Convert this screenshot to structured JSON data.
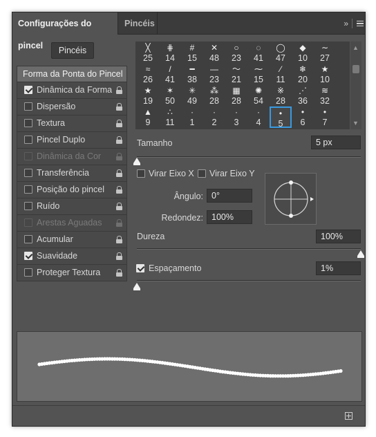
{
  "tabs": {
    "active_label": "Configurações do pincel",
    "inactive_label": "Pincéis"
  },
  "icons": {
    "collapse": "»",
    "menu": "hamburger-menu-icon",
    "new_brush": "new-brush-icon",
    "lock": "lock-icon"
  },
  "sidebar": {
    "brushes_button": "Pincéis",
    "items": [
      {
        "label": "Forma da Ponta do Pincel",
        "checkbox": false,
        "checked": false,
        "disabled": false,
        "lock": false
      },
      {
        "label": "Dinâmica da Forma",
        "checkbox": true,
        "checked": true,
        "disabled": false,
        "lock": true
      },
      {
        "label": "Dispersão",
        "checkbox": true,
        "checked": false,
        "disabled": false,
        "lock": true
      },
      {
        "label": "Textura",
        "checkbox": true,
        "checked": false,
        "disabled": false,
        "lock": true
      },
      {
        "label": "Pincel Duplo",
        "checkbox": true,
        "checked": false,
        "disabled": false,
        "lock": true
      },
      {
        "label": "Dinâmica da Cor",
        "checkbox": true,
        "checked": false,
        "disabled": true,
        "lock": true
      },
      {
        "label": "Transferência",
        "checkbox": true,
        "checked": false,
        "disabled": false,
        "lock": true
      },
      {
        "label": "Posição do pincel",
        "checkbox": true,
        "checked": false,
        "disabled": false,
        "lock": true
      },
      {
        "label": "Ruído",
        "checkbox": true,
        "checked": false,
        "disabled": false,
        "lock": true
      },
      {
        "label": "Arestas Aguadas",
        "checkbox": true,
        "checked": false,
        "disabled": true,
        "lock": true
      },
      {
        "label": "Acumular",
        "checkbox": true,
        "checked": false,
        "disabled": false,
        "lock": true
      },
      {
        "label": "Suavidade",
        "checkbox": true,
        "checked": true,
        "disabled": false,
        "lock": true
      },
      {
        "label": "Proteger Textura",
        "checkbox": true,
        "checked": false,
        "disabled": false,
        "lock": true
      }
    ]
  },
  "brush_grid": {
    "rows": [
      [
        {
          "glyph": "╳",
          "num": "25"
        },
        {
          "glyph": "⋕",
          "num": "14"
        },
        {
          "glyph": "#",
          "num": "15"
        },
        {
          "glyph": "✕",
          "num": "48"
        },
        {
          "glyph": "○",
          "num": "23"
        },
        {
          "glyph": "◌",
          "num": "41"
        },
        {
          "glyph": "◯",
          "num": "47"
        },
        {
          "glyph": "◆",
          "num": "10"
        },
        {
          "glyph": "∼",
          "num": "27"
        }
      ],
      [
        {
          "glyph": "≈",
          "num": "26"
        },
        {
          "glyph": "/",
          "num": "41"
        },
        {
          "glyph": "━",
          "num": "38"
        },
        {
          "glyph": "—",
          "num": "23"
        },
        {
          "glyph": "～",
          "num": "21"
        },
        {
          "glyph": "⁓",
          "num": "15"
        },
        {
          "glyph": "⁄",
          "num": "11"
        },
        {
          "glyph": "❄",
          "num": "20"
        },
        {
          "glyph": "★",
          "num": "10"
        }
      ],
      [
        {
          "glyph": "★",
          "num": "19"
        },
        {
          "glyph": "✶",
          "num": "50"
        },
        {
          "glyph": "✳",
          "num": "49"
        },
        {
          "glyph": "⁂",
          "num": "28"
        },
        {
          "glyph": "▦",
          "num": "28"
        },
        {
          "glyph": "✺",
          "num": "54"
        },
        {
          "glyph": "※",
          "num": "28"
        },
        {
          "glyph": "⋰",
          "num": "36"
        },
        {
          "glyph": "≋",
          "num": "32"
        }
      ],
      [
        {
          "glyph": "▲",
          "num": "9"
        },
        {
          "glyph": "∴",
          "num": "11"
        },
        {
          "glyph": "·",
          "num": "1"
        },
        {
          "glyph": "·",
          "num": "2"
        },
        {
          "glyph": "·",
          "num": "3"
        },
        {
          "glyph": "·",
          "num": "4"
        },
        {
          "glyph": "•",
          "num": "5",
          "selected": true
        },
        {
          "glyph": "•",
          "num": "6"
        },
        {
          "glyph": "•",
          "num": "7"
        }
      ]
    ]
  },
  "size": {
    "label": "Tamanho",
    "value": "5 px",
    "slider_fraction": 0.0
  },
  "flip": {
    "x_label": "Virar Eixo X",
    "x_checked": false,
    "y_label": "Virar Eixo Y",
    "y_checked": false
  },
  "angle": {
    "label": "Ângulo:",
    "value": "0°"
  },
  "roundness": {
    "label": "Redondez:",
    "value": "100%"
  },
  "hardness": {
    "label": "Dureza",
    "value": "100%",
    "slider_fraction": 1.0
  },
  "spacing": {
    "label": "Espaçamento",
    "checked": true,
    "value": "1%",
    "slider_fraction": 0.0
  },
  "colors": {
    "panel_bg": "#535353",
    "selection": "#3a9ae0",
    "preview_bg": "#6e6e6e",
    "stroke": "#ffffff"
  }
}
